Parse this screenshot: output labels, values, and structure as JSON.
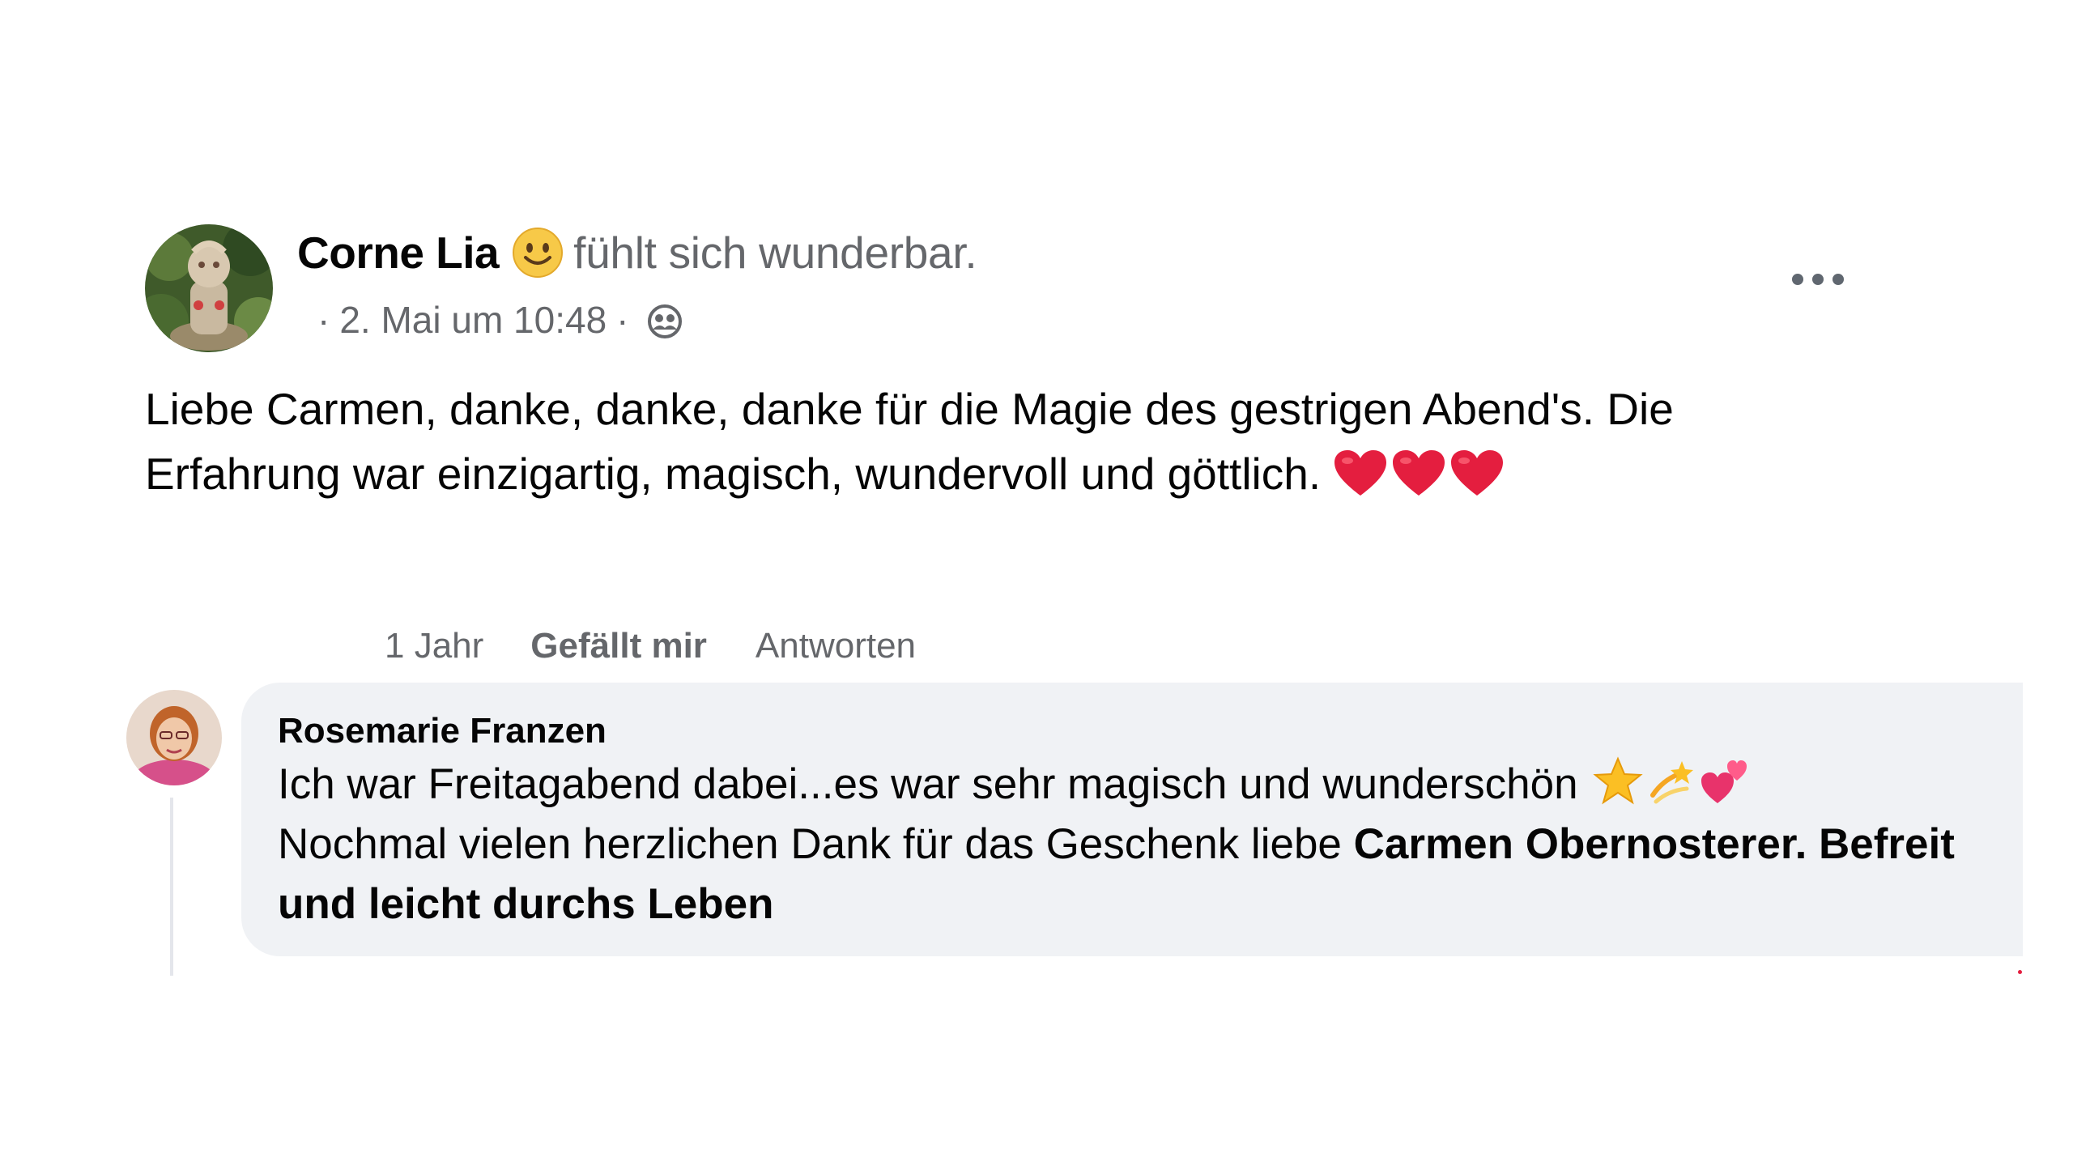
{
  "post": {
    "author_name": "Corne Lia",
    "feeling_icon": "smiling-face-emoji",
    "feeling_text": "fühlt sich wunderbar.",
    "meta_separator": "·",
    "date": "2. Mai um 10:48",
    "audience_icon": "friends-audience-icon",
    "more_icon": "more-options-icon",
    "text_line_1": "Liebe Carmen, danke, danke, danke für die Magie des gestrigen Abend's. Die",
    "text_line_2": "Erfahrung war einzigartig, magisch, wundervoll und göttlich.",
    "trailing_emojis": [
      "red-heart",
      "red-heart",
      "red-heart"
    ]
  },
  "actions": {
    "age": "1 Jahr",
    "like_label": "Gefällt mir",
    "reply_label": "Antworten"
  },
  "comment": {
    "author_name": "Rosemarie Franzen",
    "line_1": "Ich war Freitagabend dabei...es war sehr magisch und wunderschön",
    "line_1_emojis": [
      "star",
      "dizzy-star",
      "two-hearts"
    ],
    "line_2_regular": "Nochmal vielen herzlichen Dank für das Geschenk liebe",
    "line_2_bold": "Carmen Obernosterer. Befreit",
    "line_3_bold": "und leicht durchs Leben"
  },
  "colors": {
    "text_primary": "#050505",
    "text_secondary": "#65676b",
    "bubble_background": "#f0f2f5",
    "heart_red": "#e41e3f"
  }
}
